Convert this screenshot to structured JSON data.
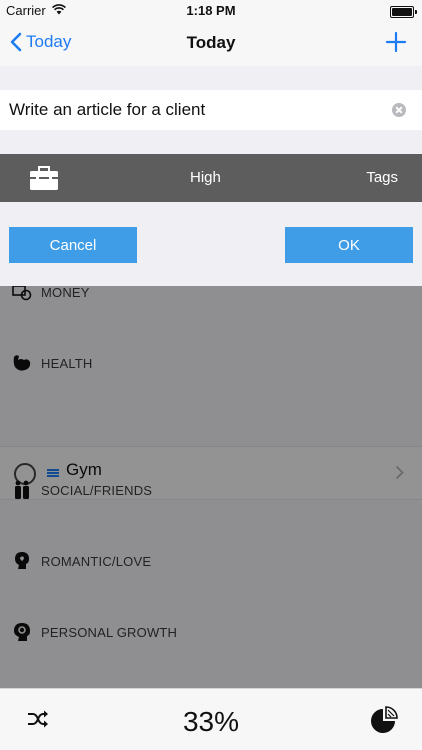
{
  "status_bar": {
    "carrier": "Carrier",
    "time": "1:18 PM"
  },
  "nav": {
    "back_label": "Today",
    "title": "Today",
    "add_icon": "plus-icon"
  },
  "background_list": {
    "categories": [
      {
        "label": "MONEY",
        "icon": "money-icon"
      },
      {
        "label": "HEALTH",
        "icon": "muscle-icon"
      },
      {
        "label": "SOCIAL/FRIENDS",
        "icon": "people-icon"
      },
      {
        "label": "ROMANTIC/LOVE",
        "icon": "heart-head-icon"
      },
      {
        "label": "PERSONAL GROWTH",
        "icon": "brain-gear-icon"
      }
    ],
    "task": {
      "name": "Gym"
    }
  },
  "modal": {
    "task_text": "Write an article for a client",
    "category_icon": "briefcase-icon",
    "priority": "High",
    "tags_label": "Tags",
    "cancel_label": "Cancel",
    "ok_label": "OK"
  },
  "toolbar": {
    "progress": "33%",
    "left_icon": "shuffle-icon",
    "right_icon": "pie-chart-icon"
  },
  "colors": {
    "accent": "#1e7cf2",
    "button": "#3f9de8",
    "options_bar": "#5d5d5d"
  }
}
